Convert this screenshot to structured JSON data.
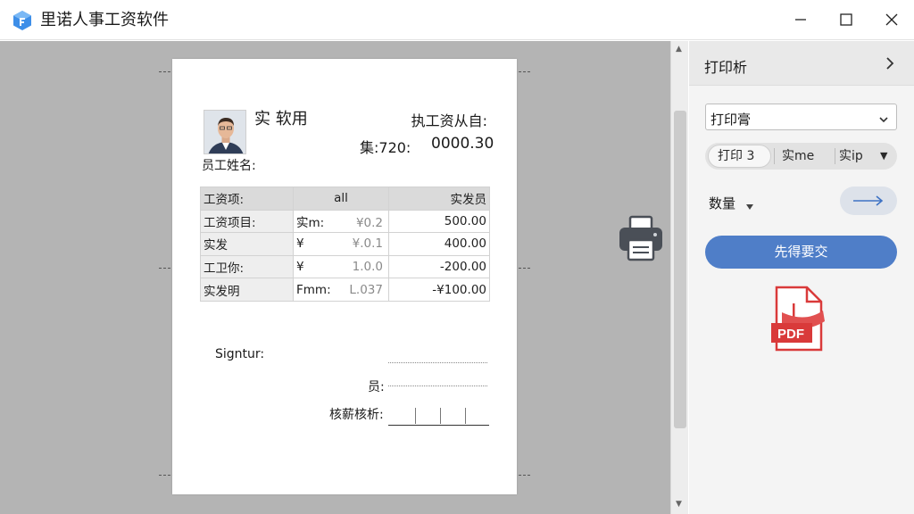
{
  "window": {
    "title": "里诺人事工资软件",
    "minimize_icon": "minimize-icon",
    "maximize_icon": "maximize-icon",
    "close_icon": "close-icon"
  },
  "slip": {
    "company_name": "实 软用",
    "employee_label": "员工姓名:",
    "title": "执工资从自:",
    "period_label": "集:720:",
    "period_total": "0000.30",
    "table": {
      "headers": [
        "工资项:",
        "all",
        "实发员"
      ],
      "rows": [
        {
          "item": "工资项目:",
          "currency": "实m:",
          "rate": "¥0.2",
          "amount": "500.00"
        },
        {
          "item": "实发",
          "currency": "¥",
          "rate": "¥.0.1",
          "amount": "400.00"
        },
        {
          "item": "工卫你:",
          "currency": "¥",
          "rate": "1.0.0",
          "amount": "-200.00"
        },
        {
          "item": "实发明",
          "currency": "Fmm:",
          "rate": "L.037",
          "amount": "-¥100.00"
        }
      ]
    },
    "signature_label": "Signtur:",
    "employee_sign_label": "员:",
    "approval_label": "核薪核析:"
  },
  "panel": {
    "title": "打印析",
    "printer_select": "打印膏",
    "segments": [
      "打印 3",
      "实me",
      "实ip"
    ],
    "copies_label": "数量",
    "submit_label": "先得要交",
    "pdf_label": "PDF"
  },
  "colors": {
    "accent": "#4f7ec8",
    "pdf_red": "#d93a3a",
    "canvas_bg": "#b4b4b4"
  }
}
